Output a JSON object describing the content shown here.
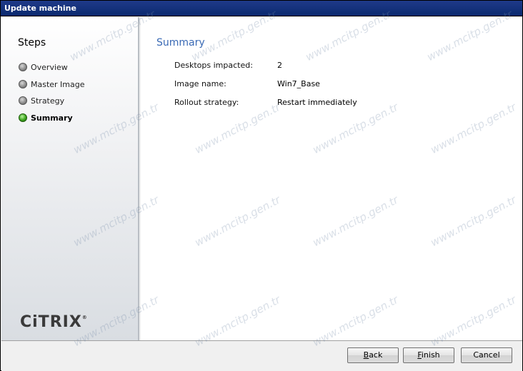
{
  "window": {
    "title": "Update machine"
  },
  "sidebar": {
    "heading": "Steps",
    "steps": [
      {
        "label": "Overview",
        "active": false
      },
      {
        "label": "Master Image",
        "active": false
      },
      {
        "label": "Strategy",
        "active": false
      },
      {
        "label": "Summary",
        "active": true
      }
    ],
    "logo_text": "CiTRIX",
    "logo_mark": "®"
  },
  "main": {
    "heading": "Summary",
    "rows": [
      {
        "label": "Desktops impacted:",
        "value": "2"
      },
      {
        "label": "Image name:",
        "value": "Win7_Base"
      },
      {
        "label": "Rollout strategy:",
        "value": "Restart immediately"
      }
    ]
  },
  "footer": {
    "back": {
      "pre": "",
      "mnemonic": "B",
      "post": "ack"
    },
    "finish": {
      "pre": "",
      "mnemonic": "F",
      "post": "inish"
    },
    "cancel": {
      "label": "Cancel"
    }
  },
  "watermark": "www.mcitp.gen.tr",
  "colors": {
    "titlebar": "#0b2a6f",
    "heading_accent": "#3a6ab5",
    "active_step": "#3ca41e"
  }
}
